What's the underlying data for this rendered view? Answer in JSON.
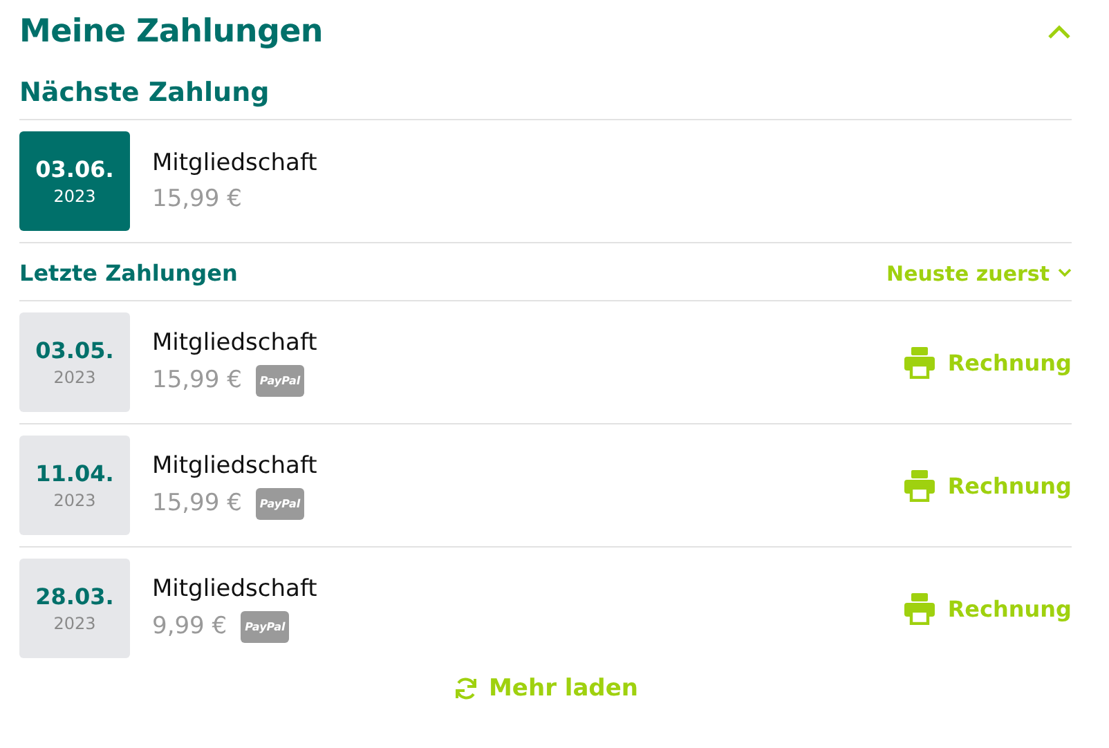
{
  "title": "Meine Zahlungen",
  "expanded": true,
  "next": {
    "heading": "Nächste Zahlung",
    "date": "03.06.",
    "year": "2023",
    "name": "Mitgliedschaft",
    "amount": "15,99 €"
  },
  "recent": {
    "heading": "Letzte Zahlungen",
    "sort": "Neuste zuerst",
    "items": [
      {
        "date": "03.05.",
        "year": "2023",
        "name": "Mitgliedschaft",
        "amount": "15,99 €",
        "method": "PayPal",
        "action": "Rechnung"
      },
      {
        "date": "11.04.",
        "year": "2023",
        "name": "Mitgliedschaft",
        "amount": "15,99 €",
        "method": "PayPal",
        "action": "Rechnung"
      },
      {
        "date": "28.03.",
        "year": "2023",
        "name": "Mitgliedschaft",
        "amount": "9,99 €",
        "method": "PayPal",
        "action": "Rechnung"
      }
    ]
  },
  "load_more": "Mehr laden"
}
